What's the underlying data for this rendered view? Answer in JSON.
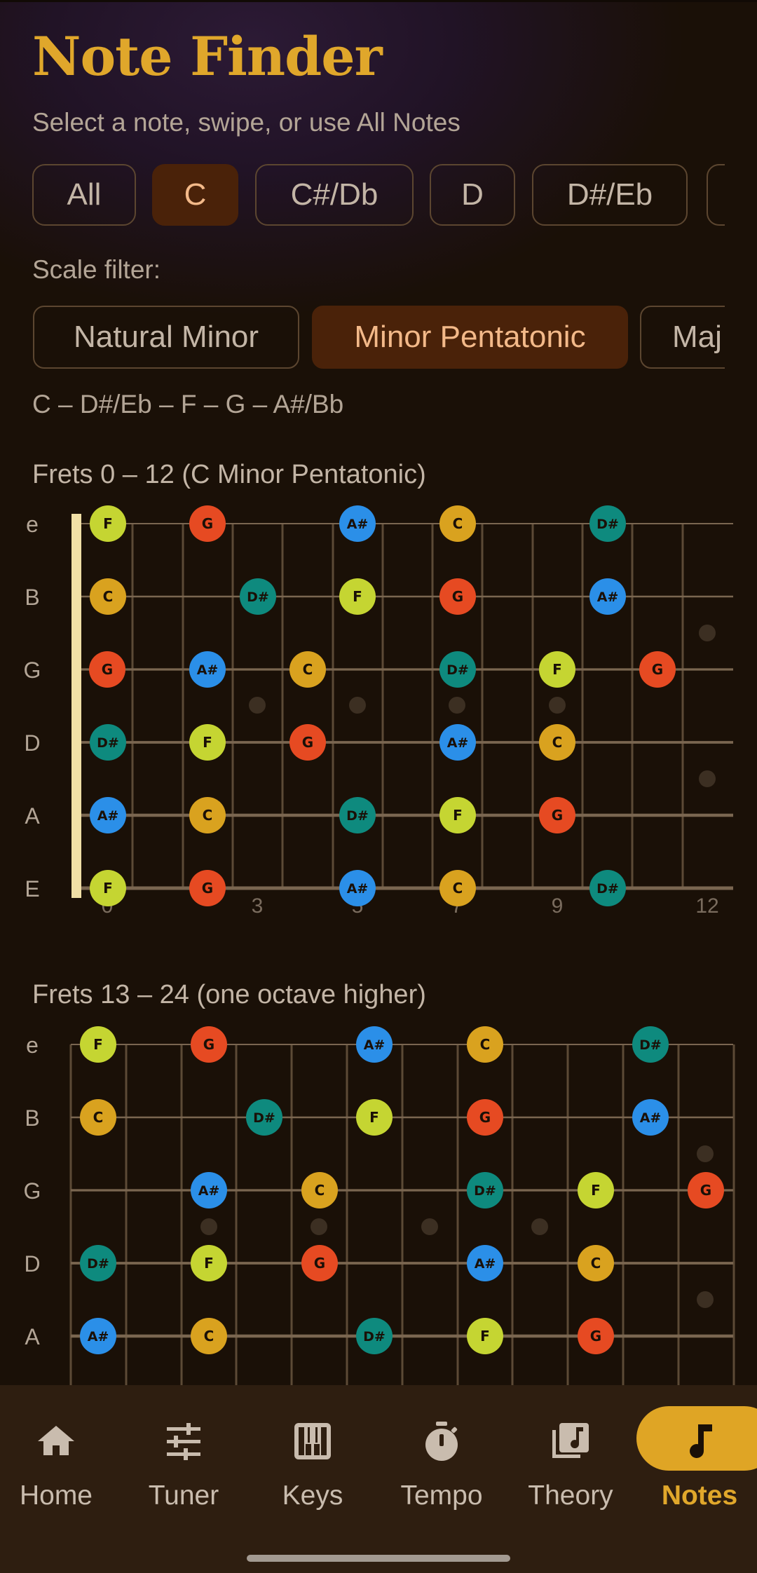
{
  "header": {
    "title": "Note Finder",
    "subtitle": "Select a note, swipe, or use All Notes"
  },
  "note_chips": [
    {
      "label": "All",
      "selected": false
    },
    {
      "label": "C",
      "selected": true
    },
    {
      "label": "C#/Db",
      "selected": false
    },
    {
      "label": "D",
      "selected": false
    },
    {
      "label": "D#/Eb",
      "selected": false
    },
    {
      "label": "",
      "selected": false
    }
  ],
  "scale_filter": {
    "label": "Scale filter:",
    "chips": [
      {
        "label": "Natural Minor",
        "selected": false
      },
      {
        "label": "Minor Pentatonic",
        "selected": true
      },
      {
        "label": "Maj",
        "selected": false
      }
    ],
    "notes_text": "C – D#/Eb – F – G – A#/Bb"
  },
  "colors": {
    "C": "#d9a21f",
    "D#": "#0e8a7e",
    "F": "#c5d532",
    "G": "#e64a22",
    "A#": "#2b8fe8",
    "accent": "#e0a72b",
    "background": "#1a1007"
  },
  "boards": [
    {
      "title": "Frets 0 – 12  (C Minor Pentatonic)",
      "strings": [
        "e",
        "B",
        "G",
        "D",
        "A",
        "E"
      ],
      "fret_numbers": [
        "0",
        "3",
        "5",
        "7",
        "9",
        "12"
      ],
      "notes": {
        "e": [
          [
            1,
            "F"
          ],
          [
            3,
            "G"
          ],
          [
            6,
            "A#"
          ],
          [
            8,
            "C"
          ],
          [
            11,
            "D#"
          ]
        ],
        "B": [
          [
            1,
            "C"
          ],
          [
            4,
            "D#"
          ],
          [
            6,
            "F"
          ],
          [
            8,
            "G"
          ],
          [
            11,
            "A#"
          ]
        ],
        "G": [
          [
            0,
            "G"
          ],
          [
            3,
            "A#"
          ],
          [
            5,
            "C"
          ],
          [
            8,
            "D#"
          ],
          [
            10,
            "F"
          ],
          [
            12,
            "G"
          ]
        ],
        "D": [
          [
            1,
            "D#"
          ],
          [
            3,
            "F"
          ],
          [
            5,
            "G"
          ],
          [
            8,
            "A#"
          ],
          [
            10,
            "C"
          ]
        ],
        "A": [
          [
            1,
            "A#"
          ],
          [
            3,
            "C"
          ],
          [
            6,
            "D#"
          ],
          [
            8,
            "F"
          ],
          [
            10,
            "G"
          ]
        ],
        "E": [
          [
            1,
            "F"
          ],
          [
            3,
            "G"
          ],
          [
            6,
            "A#"
          ],
          [
            8,
            "C"
          ],
          [
            11,
            "D#"
          ]
        ]
      }
    },
    {
      "title": "Frets 13 – 24  (one octave higher)",
      "strings": [
        "e",
        "B",
        "G",
        "D",
        "A"
      ],
      "notes": {
        "e": [
          [
            13,
            "F"
          ],
          [
            15,
            "G"
          ],
          [
            18,
            "A#"
          ],
          [
            20,
            "C"
          ],
          [
            23,
            "D#"
          ]
        ],
        "B": [
          [
            13,
            "C"
          ],
          [
            16,
            "D#"
          ],
          [
            18,
            "F"
          ],
          [
            20,
            "G"
          ],
          [
            23,
            "A#"
          ]
        ],
        "G": [
          [
            15,
            "A#"
          ],
          [
            17,
            "C"
          ],
          [
            20,
            "D#"
          ],
          [
            22,
            "F"
          ],
          [
            24,
            "G"
          ]
        ],
        "D": [
          [
            13,
            "D#"
          ],
          [
            15,
            "F"
          ],
          [
            17,
            "G"
          ],
          [
            20,
            "A#"
          ],
          [
            22,
            "C"
          ]
        ],
        "A": [
          [
            13,
            "A#"
          ],
          [
            15,
            "C"
          ],
          [
            18,
            "D#"
          ],
          [
            20,
            "F"
          ],
          [
            22,
            "G"
          ]
        ]
      }
    }
  ],
  "nav": {
    "items": [
      {
        "label": "Home",
        "icon": "home-icon"
      },
      {
        "label": "Tuner",
        "icon": "sliders-icon"
      },
      {
        "label": "Keys",
        "icon": "piano-icon"
      },
      {
        "label": "Tempo",
        "icon": "stopwatch-icon"
      },
      {
        "label": "Theory",
        "icon": "music-library-icon"
      },
      {
        "label": "Notes",
        "icon": "music-note-icon",
        "active": true
      }
    ]
  }
}
